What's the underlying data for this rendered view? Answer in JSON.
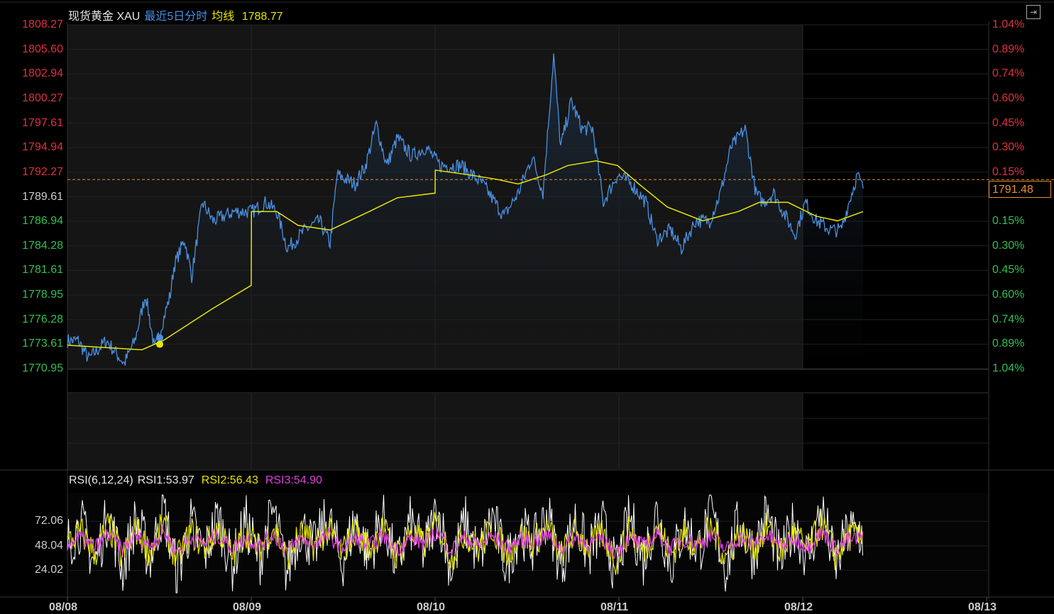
{
  "header": {
    "name": "现货黄金 XAU",
    "period": "最近5日分时",
    "avg_label": "均线",
    "avg_value": "1788.77"
  },
  "current_price": "1791.48",
  "rsi_header": {
    "params": "RSI(6,12,24)",
    "rsi1": "RSI1:53.97",
    "rsi2": "RSI2:56.43",
    "rsi3": "RSI3:54.90"
  },
  "colors": {
    "price": "#4a90e2",
    "avg": "#e6e600",
    "up": "#e03040",
    "down": "#30c050",
    "rsi1": "#ffffff",
    "rsi2": "#e6e600",
    "rsi3": "#e040e0",
    "ref": "#e8902a"
  },
  "chart_data": {
    "type": "line",
    "title": "现货黄金 XAU 最近5日分时",
    "x_unit": "days since 08/08",
    "x_ticks": [
      "08/08",
      "08/09",
      "08/10",
      "08/11",
      "08/12",
      "08/13"
    ],
    "ylim": [
      1770.95,
      1808.27
    ],
    "reference_price": 1791.48,
    "y_ticks": [
      "1808.27",
      "1805.60",
      "1802.94",
      "1800.27",
      "1797.61",
      "1794.94",
      "1792.27",
      "1789.61",
      "1786.94",
      "1784.28",
      "1781.61",
      "1778.95",
      "1776.28",
      "1773.61",
      "1770.95"
    ],
    "pct_ticks": [
      "1.04%",
      "0.89%",
      "0.74%",
      "0.60%",
      "0.45%",
      "0.30%",
      "0.15%",
      "0.00%",
      "0.15%",
      "0.30%",
      "0.45%",
      "0.60%",
      "0.74%",
      "0.89%",
      "1.04%"
    ],
    "price": [
      [
        0,
        1774
      ],
      [
        0.058,
        1774
      ],
      [
        0.116,
        1772
      ],
      [
        0.212,
        1774
      ],
      [
        0.309,
        1771.5
      ],
      [
        0.367,
        1774
      ],
      [
        0.425,
        1779
      ],
      [
        0.475,
        1773
      ],
      [
        0.56,
        1779
      ],
      [
        0.579,
        1782
      ],
      [
        0.637,
        1785
      ],
      [
        0.676,
        1781
      ],
      [
        0.734,
        1789
      ],
      [
        0.792,
        1787
      ],
      [
        0.907,
        1788
      ],
      [
        1.004,
        1788
      ],
      [
        1.081,
        1789
      ],
      [
        1.139,
        1788
      ],
      [
        1.197,
        1784
      ],
      [
        1.293,
        1786
      ],
      [
        1.371,
        1787
      ],
      [
        1.429,
        1784.5
      ],
      [
        1.467,
        1792
      ],
      [
        1.564,
        1791
      ],
      [
        1.622,
        1793
      ],
      [
        1.68,
        1797.5
      ],
      [
        1.737,
        1793
      ],
      [
        1.795,
        1796
      ],
      [
        1.873,
        1794
      ],
      [
        1.95,
        1795
      ],
      [
        2.027,
        1793
      ],
      [
        2.143,
        1793
      ],
      [
        2.259,
        1791
      ],
      [
        2.375,
        1787.5
      ],
      [
        2.452,
        1790
      ],
      [
        2.529,
        1794
      ],
      [
        2.587,
        1790
      ],
      [
        2.645,
        1805
      ],
      [
        2.683,
        1795
      ],
      [
        2.741,
        1800
      ],
      [
        2.799,
        1797
      ],
      [
        2.857,
        1797
      ],
      [
        2.915,
        1789
      ],
      [
        2.992,
        1792
      ],
      [
        3.069,
        1791
      ],
      [
        3.147,
        1789
      ],
      [
        3.205,
        1785
      ],
      [
        3.282,
        1786
      ],
      [
        3.34,
        1784
      ],
      [
        3.417,
        1787
      ],
      [
        3.494,
        1787
      ],
      [
        3.552,
        1790
      ],
      [
        3.61,
        1795
      ],
      [
        3.687,
        1797
      ],
      [
        3.745,
        1790
      ],
      [
        3.784,
        1789
      ],
      [
        3.842,
        1790
      ],
      [
        3.919,
        1787
      ],
      [
        3.958,
        1785.5
      ],
      [
        4.015,
        1789
      ],
      [
        4.073,
        1787
      ],
      [
        4.151,
        1786
      ],
      [
        4.208,
        1786
      ],
      [
        4.266,
        1790
      ],
      [
        4.297,
        1792
      ],
      [
        4.328,
        1790.5
      ]
    ],
    "average": [
      [
        0,
        1773.5
      ],
      [
        0.405,
        1773
      ],
      [
        0.521,
        1774
      ],
      [
        0.792,
        1777.5
      ],
      [
        1.0,
        1780
      ],
      [
        1.001,
        1788
      ],
      [
        1.139,
        1788
      ],
      [
        1.255,
        1786.5
      ],
      [
        1.429,
        1786
      ],
      [
        1.641,
        1788
      ],
      [
        1.795,
        1789.5
      ],
      [
        2.0,
        1790
      ],
      [
        2.001,
        1792.5
      ],
      [
        2.181,
        1792
      ],
      [
        2.336,
        1791.5
      ],
      [
        2.452,
        1791
      ],
      [
        2.606,
        1792
      ],
      [
        2.722,
        1793
      ],
      [
        2.876,
        1793.5
      ],
      [
        2.992,
        1793
      ],
      [
        3.108,
        1791
      ],
      [
        3.263,
        1788.5
      ],
      [
        3.456,
        1787
      ],
      [
        3.649,
        1788
      ],
      [
        3.764,
        1789
      ],
      [
        3.919,
        1789
      ],
      [
        4.073,
        1787.5
      ],
      [
        4.189,
        1787
      ],
      [
        4.328,
        1788
      ]
    ],
    "marker": [
      0.502,
      1773.6
    ],
    "rsi": {
      "ylim": [
        0,
        100
      ],
      "y_ticks": [
        "72.06",
        "48.04",
        "24.02"
      ],
      "rsi1": [
        50,
        70,
        30,
        80,
        25,
        75,
        35,
        85,
        20,
        70,
        40,
        78,
        28,
        72,
        35,
        82,
        22,
        68,
        45,
        76,
        30,
        74,
        38,
        80,
        26,
        70,
        42,
        84,
        24,
        72,
        36,
        78,
        30,
        66,
        48,
        80,
        28,
        74,
        40,
        70,
        22,
        76,
        34,
        82,
        30,
        68,
        44,
        78,
        26,
        72,
        40,
        80,
        32,
        70,
        36,
        84,
        28,
        64,
        58
      ],
      "rsi2": [
        50,
        62,
        40,
        68,
        36,
        64,
        42,
        70,
        34,
        62,
        46,
        66,
        38,
        62,
        44,
        68,
        36,
        60,
        48,
        64,
        40,
        64,
        44,
        66,
        38,
        62,
        48,
        70,
        36,
        62,
        44,
        66,
        40,
        58,
        52,
        66,
        38,
        62,
        46,
        60,
        34,
        64,
        42,
        68,
        40,
        60,
        48,
        66,
        36,
        62,
        46,
        66,
        42,
        60,
        44,
        70,
        38,
        58,
        56
      ],
      "rsi3": [
        50,
        56,
        46,
        60,
        44,
        58,
        48,
        62,
        42,
        56,
        50,
        58,
        46,
        56,
        48,
        60,
        44,
        54,
        50,
        58,
        46,
        56,
        48,
        58,
        44,
        56,
        50,
        62,
        44,
        56,
        48,
        58,
        46,
        54,
        52,
        58,
        46,
        56,
        50,
        54,
        42,
        56,
        48,
        60,
        46,
        54,
        50,
        58,
        44,
        56,
        50,
        58,
        48,
        54,
        48,
        62,
        46,
        54,
        55
      ]
    }
  }
}
